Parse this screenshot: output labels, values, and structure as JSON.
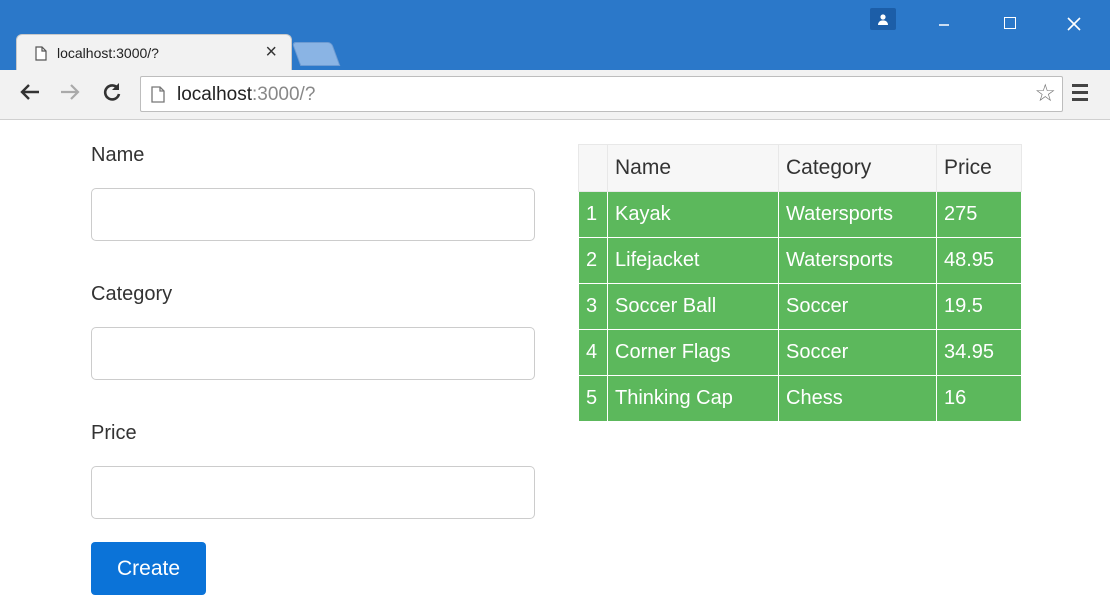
{
  "browser": {
    "tab_title": "localhost:3000/?",
    "tab_close": "×",
    "url_host": "localhost",
    "url_rest": ":3000/?"
  },
  "form": {
    "name_label": "Name",
    "category_label": "Category",
    "price_label": "Price",
    "name_value": "",
    "category_value": "",
    "price_value": "",
    "create_label": "Create"
  },
  "table": {
    "headers": [
      "",
      "Name",
      "Category",
      "Price"
    ],
    "rows": [
      [
        "1",
        "Kayak",
        "Watersports",
        "275"
      ],
      [
        "2",
        "Lifejacket",
        "Watersports",
        "48.95"
      ],
      [
        "3",
        "Soccer Ball",
        "Soccer",
        "19.5"
      ],
      [
        "4",
        "Corner Flags",
        "Soccer",
        "34.95"
      ],
      [
        "5",
        "Thinking Cap",
        "Chess",
        "16"
      ]
    ]
  },
  "colors": {
    "titlebar": "#2b78c9",
    "row_background": "#5cb85c",
    "button": "#0b73d8"
  }
}
